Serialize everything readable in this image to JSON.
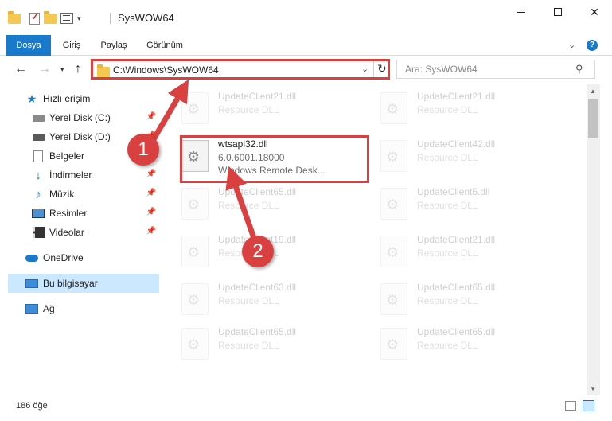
{
  "window": {
    "title": "SysWOW64",
    "minimize_icon": "minimize-icon",
    "maximize_icon": "maximize-icon",
    "close_glyph": "✕"
  },
  "ribbon": {
    "tabs": [
      {
        "label": "Dosya"
      },
      {
        "label": "Giriş"
      },
      {
        "label": "Paylaş"
      },
      {
        "label": "Görünüm"
      }
    ],
    "accent": "#1979ca"
  },
  "nav": {
    "address": "C:\\Windows\\SysWOW64",
    "search_placeholder": "Ara: SysWOW64"
  },
  "sidebar": {
    "items": [
      {
        "label": "Hızlı erişim",
        "icon": "star-icon"
      },
      {
        "label": "Yerel Disk (C:)",
        "icon": "drive-icon",
        "pinned": true
      },
      {
        "label": "Yerel Disk (D:)",
        "icon": "drive-icon",
        "pinned": true
      },
      {
        "label": "Belgeler",
        "icon": "documents-icon",
        "pinned": true
      },
      {
        "label": "İndirmeler",
        "icon": "download-icon",
        "pinned": true
      },
      {
        "label": "Müzik",
        "icon": "music-icon",
        "pinned": true
      },
      {
        "label": "Resimler",
        "icon": "pictures-icon",
        "pinned": true
      },
      {
        "label": "Videolar",
        "icon": "videos-icon",
        "pinned": true
      },
      {
        "label": "OneDrive",
        "icon": "onedrive-icon"
      },
      {
        "label": "Bu bilgisayar",
        "icon": "computer-icon",
        "selected": true
      },
      {
        "label": "Ağ",
        "icon": "network-icon"
      }
    ]
  },
  "files": [
    {
      "name": "UpdateClient21.dll",
      "type": "Resource DLL"
    },
    {
      "name": "UpdateClient21.dll",
      "type": "Resource DLL"
    },
    {
      "name": "wtsapi32.dll",
      "version": "6.0.6001.18000",
      "description": "Windows Remote Desk..."
    },
    {
      "name": "UpdateClient42.dll",
      "type": "Resource DLL"
    },
    {
      "name": "UpdateClient65.dll",
      "type": "Resource DLL"
    },
    {
      "name": "UpdateClient5.dll",
      "type": "Resource DLL"
    },
    {
      "name": "UpdateClient19.dll",
      "type": "Resource DLL"
    },
    {
      "name": "UpdateClient21.dll",
      "type": "Resource DLL"
    },
    {
      "name": "UpdateClient63.dll",
      "type": "Resource DLL"
    },
    {
      "name": "UpdateClient65.dll",
      "type": "Resource DLL"
    },
    {
      "name": "UpdateClient65.dll",
      "type": "Resource DLL"
    },
    {
      "name": "UpdateClient65.dll",
      "type": "Resource DLL"
    }
  ],
  "status": {
    "item_count": "186 öğe"
  },
  "annotations": {
    "step1": "1",
    "step2": "2",
    "color": "#d94040"
  }
}
